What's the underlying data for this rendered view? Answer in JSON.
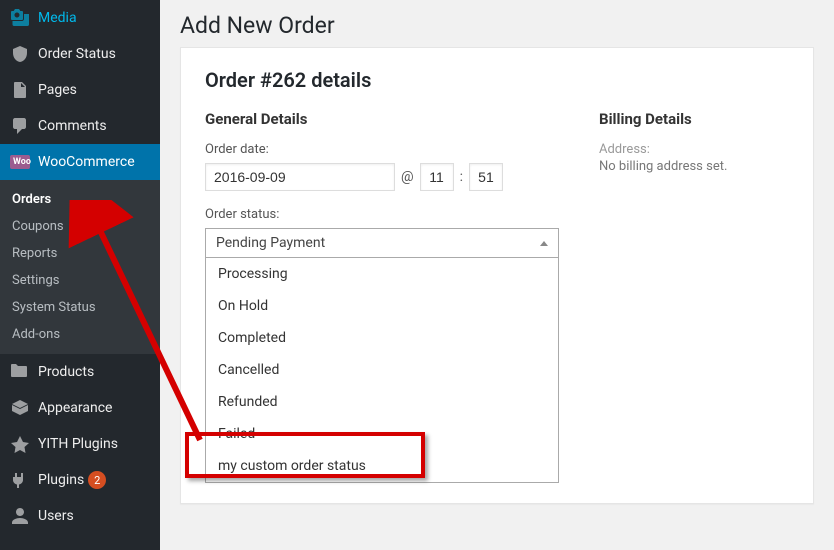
{
  "sidebar": {
    "items": [
      {
        "label": "Media",
        "icon": "media"
      },
      {
        "label": "Order Status",
        "icon": "status"
      },
      {
        "label": "Pages",
        "icon": "pages"
      },
      {
        "label": "Comments",
        "icon": "comments"
      }
    ],
    "woo_label": "WooCommerce",
    "woo_badge": "Woo",
    "submenu": [
      {
        "label": "Orders"
      },
      {
        "label": "Coupons"
      },
      {
        "label": "Reports"
      },
      {
        "label": "Settings"
      },
      {
        "label": "System Status"
      },
      {
        "label": "Add-ons"
      }
    ],
    "items2": [
      {
        "label": "Products",
        "icon": "products"
      },
      {
        "label": "Appearance",
        "icon": "appearance"
      },
      {
        "label": "YITH Plugins",
        "icon": "yith"
      },
      {
        "label": "Plugins",
        "icon": "plugins",
        "count": "2"
      },
      {
        "label": "Users",
        "icon": "users"
      }
    ]
  },
  "page": {
    "title": "Add New Order",
    "order_heading": "Order #262 details",
    "general": {
      "heading": "General Details",
      "date_label": "Order date:",
      "date_value": "2016-09-09",
      "at": "@",
      "hour": "11",
      "colon": ":",
      "minute": "51",
      "status_label": "Order status:",
      "status_selected": "Pending Payment",
      "status_options": [
        "Processing",
        "On Hold",
        "Completed",
        "Cancelled",
        "Refunded",
        "Failed",
        "my custom order status"
      ]
    },
    "billing": {
      "heading": "Billing Details",
      "address_label": "Address:",
      "address_none": "No billing address set."
    }
  },
  "annotation": {
    "highlight_target": "my custom order status"
  }
}
